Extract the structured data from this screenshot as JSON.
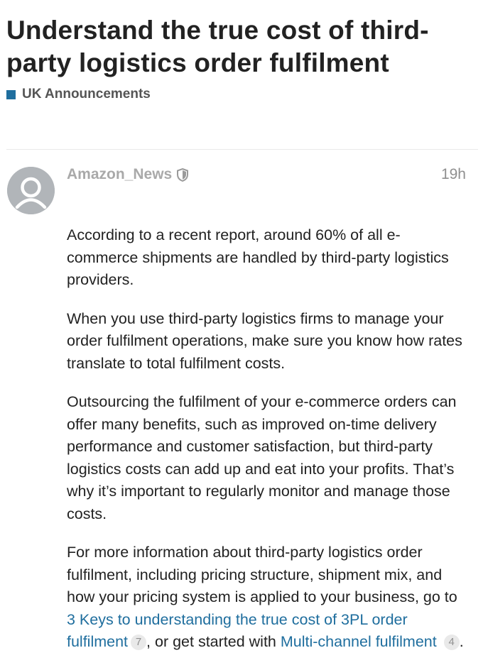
{
  "topic": {
    "title": "Understand the true cost of third-party logistics order fulfilment",
    "category": "UK Announcements",
    "category_color": "#1f6e9e"
  },
  "post": {
    "author": "Amazon_News",
    "author_badge_icon": "shield-icon",
    "date": "19h",
    "paragraphs": [
      "According to a recent report, around 60% of all e-commerce shipments are handled by third-party logistics providers.",
      "When you use third-party logistics firms to manage your order fulfilment operations, make sure you know how rates translate to total fulfilment costs.",
      "Outsourcing the fulfilment of your e-commerce orders can offer many benefits, such as improved on-time delivery performance and customer satisfaction, but third-party logistics costs can add up and eat into your profits. That’s why it’s important to regularly monitor and manage those costs."
    ],
    "last_paragraph": {
      "intro": "For more information about third-party logistics order fulfilment, including pricing structure, shipment mix, and how your pricing system is applied to your business, go to ",
      "link1_text": "3 Keys to understanding the true cost of 3PL order fulfilment",
      "link1_clicks": "7",
      "middle": ", or get started with ",
      "link2_text": "Multi-channel fulfilment",
      "link2_clicks": "4",
      "end": "."
    }
  }
}
